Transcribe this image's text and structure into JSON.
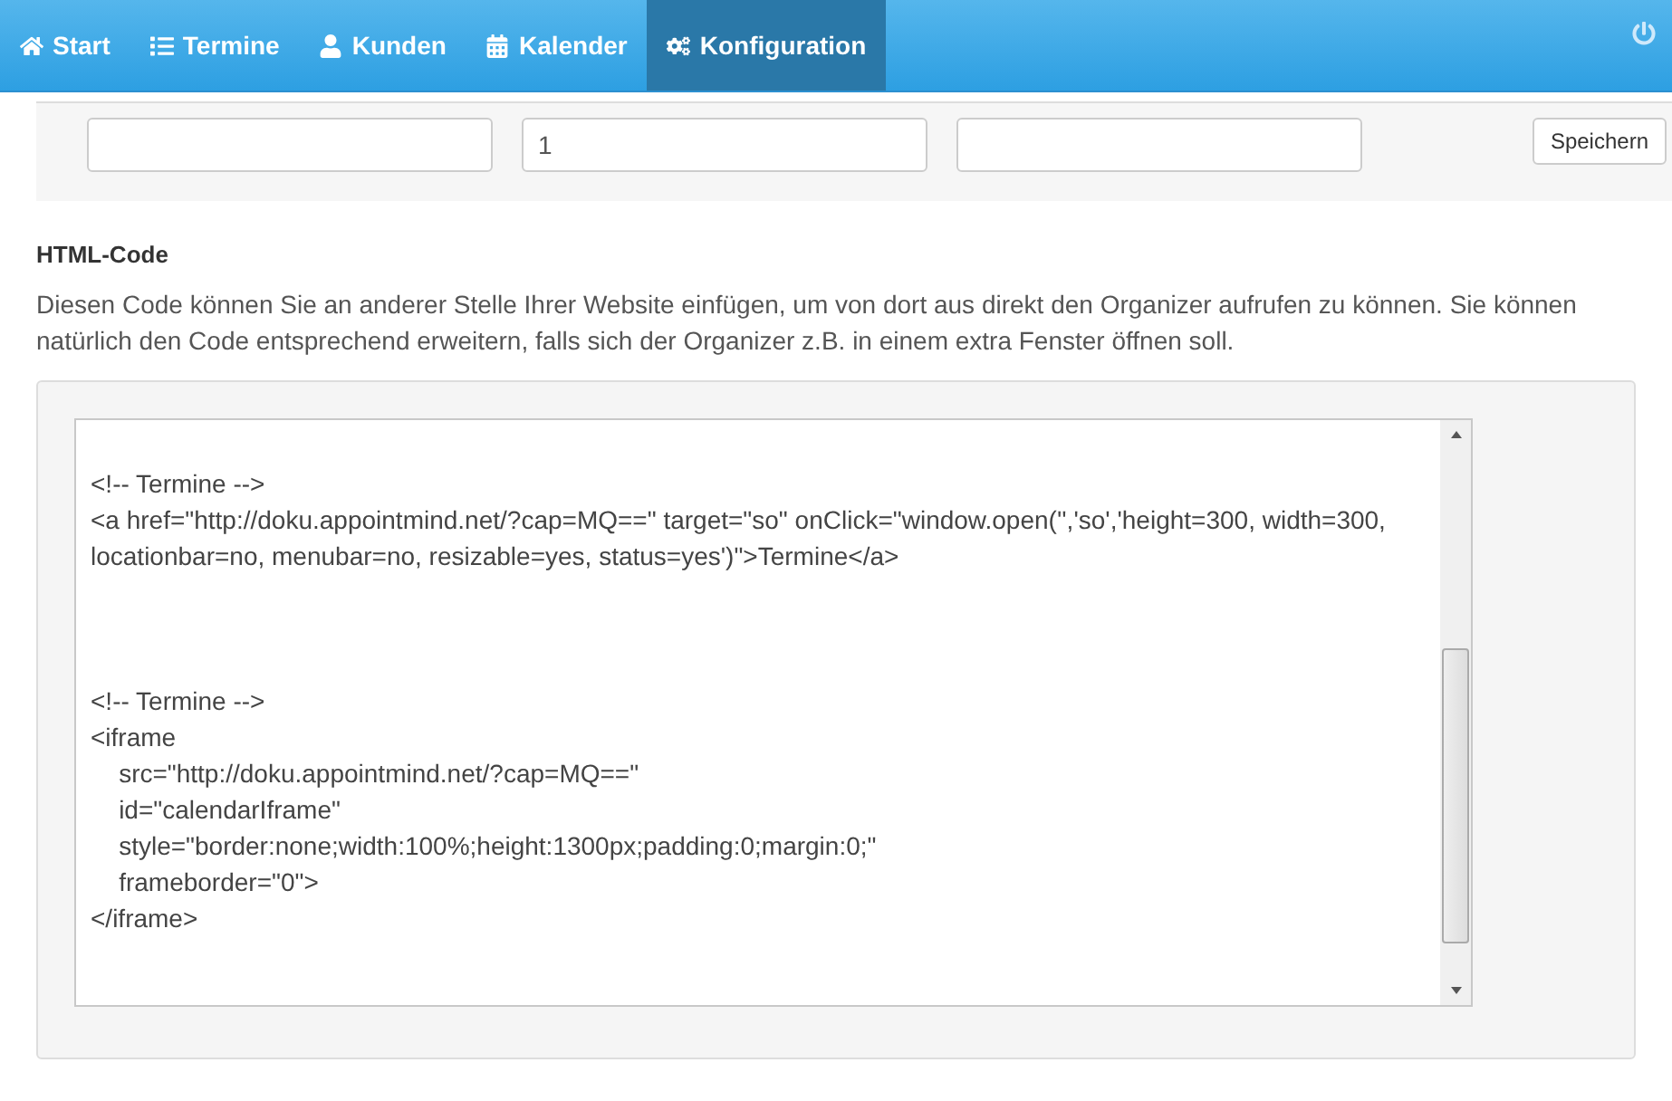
{
  "nav": {
    "items": [
      {
        "label": "Start",
        "selected": false
      },
      {
        "label": "Termine",
        "selected": false
      },
      {
        "label": "Kunden",
        "selected": false
      },
      {
        "label": "Kalender",
        "selected": false
      },
      {
        "label": "Konfiguration",
        "selected": true
      }
    ]
  },
  "form": {
    "fields": [
      {
        "kind": "text"
      },
      {
        "kind": "text",
        "value": "1"
      },
      {
        "kind": "text"
      }
    ],
    "button": "Speichern"
  },
  "section": {
    "title": "HTML-Code",
    "description": "Diesen Code können Sie an anderer Stelle Ihrer Website einfügen, um von dort aus direkt den Organizer aufrufen zu können. Sie können natürlich den Code entsprechend erweitern, falls sich der Organizer z.B. in einem extra Fenster öffnen soll."
  },
  "code": {
    "blocks": [
      [
        "<!-- Termine -->",
        "<a href=\"http://doku.appointmind.net/?cap=MQ==\" target=\"so\" onClick=\"window.open('','so','height=300, width=300, locationbar=no, menubar=no, resizable=yes, status=yes')\">Termine</a>"
      ],
      [
        "<!-- Termine -->",
        "<iframe",
        "    src=\"http://doku.appointmind.net/?cap=MQ==\"",
        "    id=\"calendarIframe\"",
        "    style=\"border:none;width:100%;height:1300px;padding:0;margin:0;\"",
        "    frameborder=\"0\">",
        "</iframe>"
      ]
    ]
  }
}
